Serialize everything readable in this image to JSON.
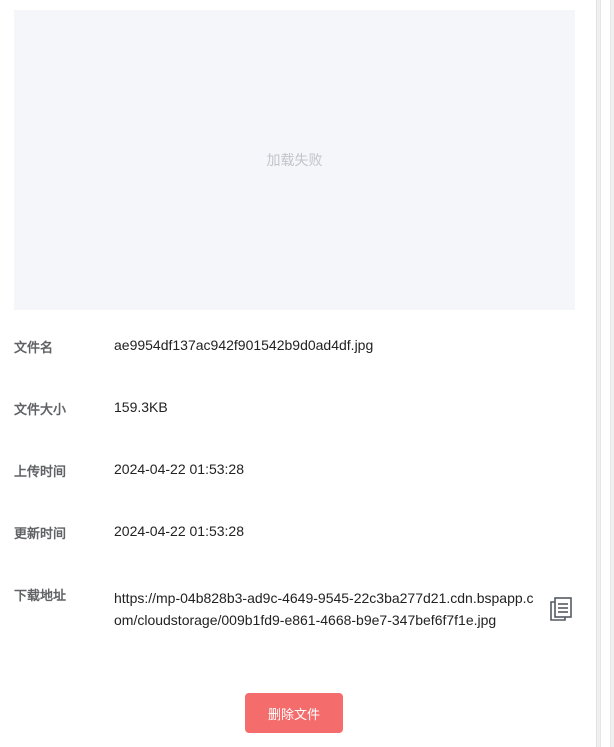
{
  "preview": {
    "error_text": "加载失败"
  },
  "info": {
    "filename_label": "文件名",
    "filename_value": "ae9954df137ac942f901542b9d0ad4df.jpg",
    "size_label": "文件大小",
    "size_value": "159.3KB",
    "upload_time_label": "上传时间",
    "upload_time_value": "2024-04-22 01:53:28",
    "update_time_label": "更新时间",
    "update_time_value": "2024-04-22 01:53:28",
    "download_label": "下载地址",
    "download_url": "https://mp-04b828b3-ad9c-4649-9545-22c3ba277d21.cdn.bspapp.com/cloudstorage/009b1fd9-e861-4668-b9e7-347bef6f7f1e.jpg",
    "copy_icon": "copy-icon"
  },
  "actions": {
    "delete_label": "删除文件"
  },
  "colors": {
    "danger": "#f56c6c",
    "preview_bg": "#f5f6f9",
    "muted_text": "#c0c4cc",
    "label_text": "#606266"
  }
}
